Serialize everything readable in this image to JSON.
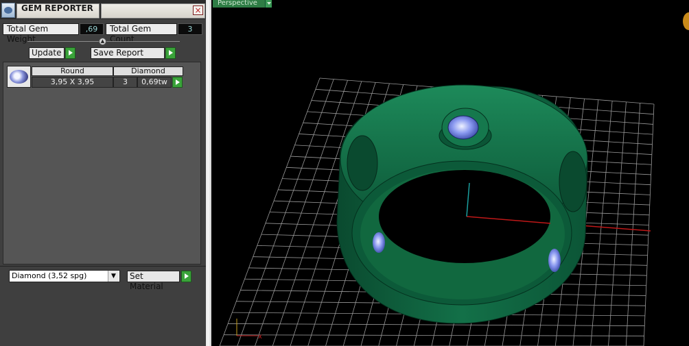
{
  "window": {
    "title": "GEM REPORTER",
    "close_label": "×"
  },
  "summary": {
    "weight_label": "Total Gem Weight",
    "weight_value": ",69",
    "count_label": "Total Gem Count",
    "count_value": "3"
  },
  "toolbar": {
    "update_label": "Update",
    "save_report_label": "Save Report"
  },
  "gem_table": {
    "columns": [
      "Round",
      "Diamond"
    ],
    "rows": [
      {
        "size": "3,95 X 3,95",
        "count": "3",
        "weight": "0,69tw"
      }
    ]
  },
  "material": {
    "selected": "Diamond     (3,52 spg)",
    "set_label": "Set Material"
  },
  "viewport": {
    "view_label": "Perspective",
    "axis_x_label": "x",
    "colors": {
      "ring": "#0d5e3c",
      "grid": "#9a9a9a",
      "x_axis": "#c01818",
      "z_axis": "#1aa0a0",
      "gem": "#7d8cf0",
      "accent_green": "#3aa33a"
    }
  }
}
